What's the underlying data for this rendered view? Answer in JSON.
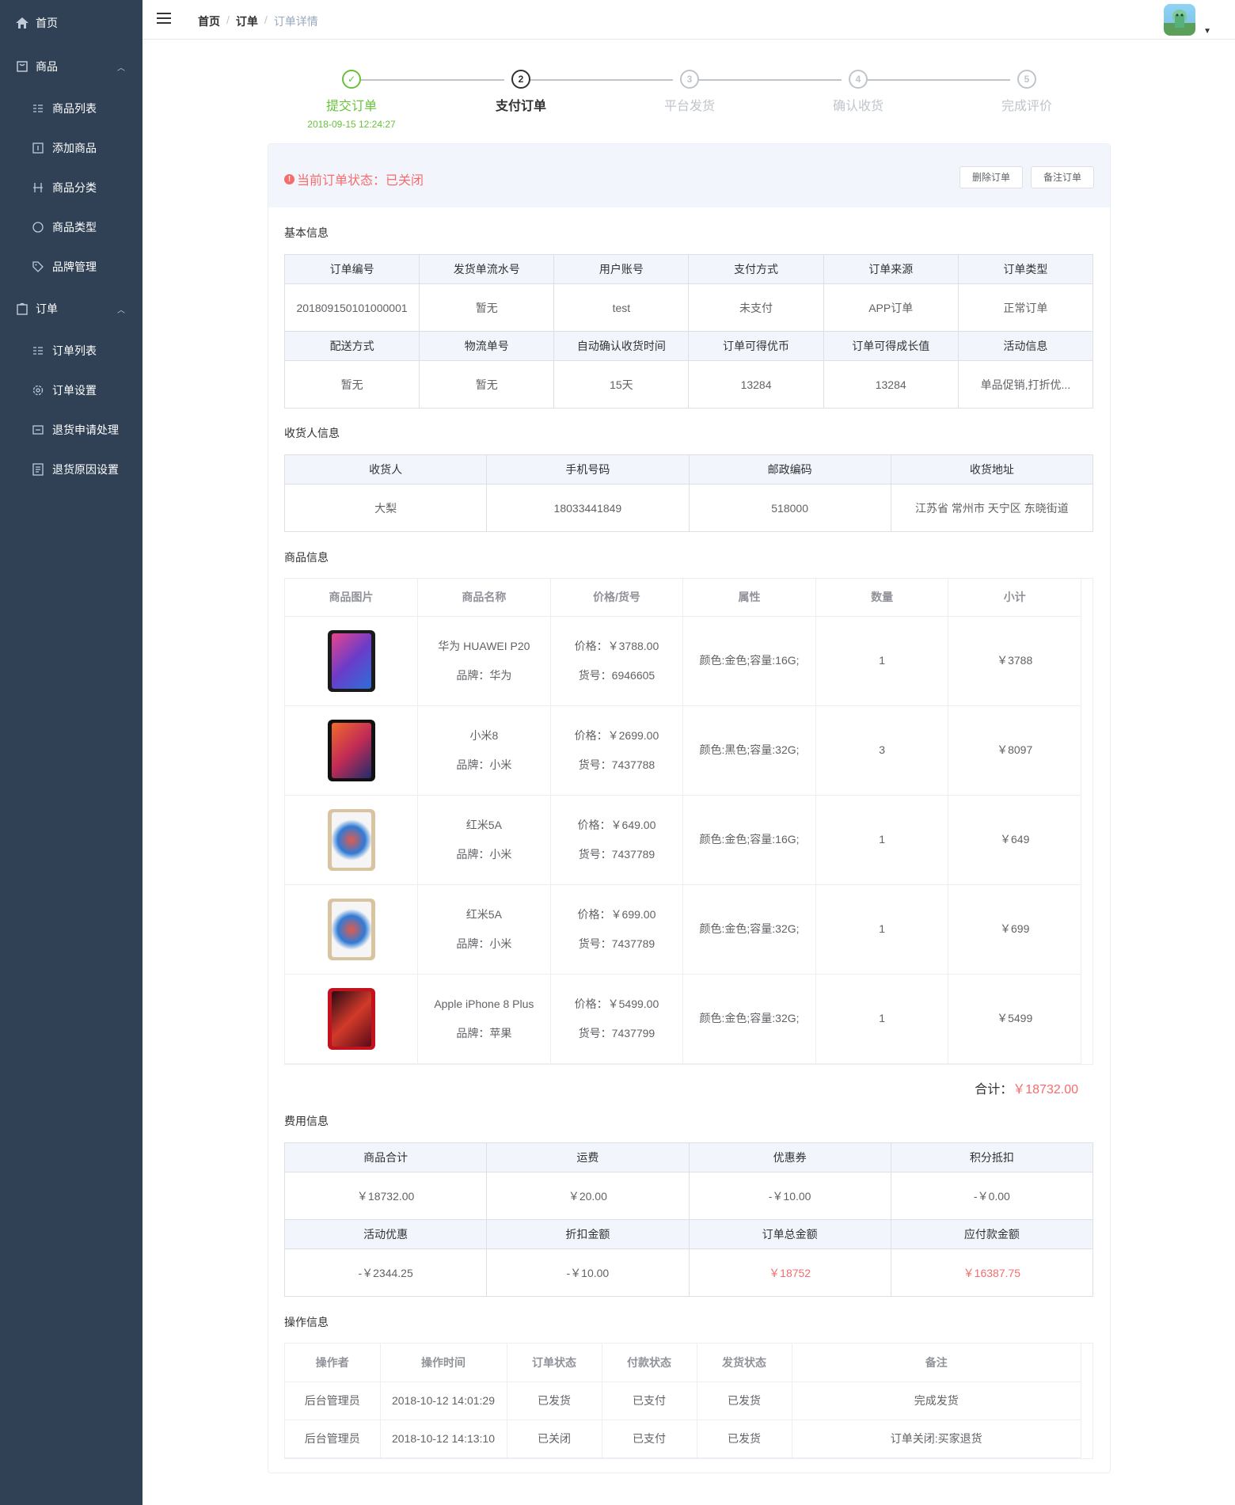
{
  "sidebar": {
    "items": [
      {
        "label": "首页",
        "icon": "home-icon"
      },
      {
        "label": "商品",
        "icon": "product-icon"
      },
      {
        "label": "商品列表",
        "icon": "list-icon"
      },
      {
        "label": "添加商品",
        "icon": "add-icon"
      },
      {
        "label": "商品分类",
        "icon": "category-icon"
      },
      {
        "label": "商品类型",
        "icon": "type-icon"
      },
      {
        "label": "品牌管理",
        "icon": "tag-icon"
      },
      {
        "label": "订单",
        "icon": "order-icon"
      },
      {
        "label": "订单列表",
        "icon": "list-icon"
      },
      {
        "label": "订单设置",
        "icon": "gear-icon"
      },
      {
        "label": "退货申请处理",
        "icon": "return-icon"
      },
      {
        "label": "退货原因设置",
        "icon": "document-icon"
      }
    ]
  },
  "breadcrumb": {
    "home": "首页",
    "sep": "/",
    "section": "订单",
    "current": "订单详情"
  },
  "steps": [
    {
      "title": "提交订单",
      "desc": "2018-09-15 12:24:27",
      "num": "✓"
    },
    {
      "title": "支付订单",
      "desc": "",
      "num": "2"
    },
    {
      "title": "平台发货",
      "desc": "",
      "num": "3"
    },
    {
      "title": "确认收货",
      "desc": "",
      "num": "4"
    },
    {
      "title": "完成评价",
      "desc": "",
      "num": "5"
    }
  ],
  "status": {
    "text": "当前订单状态：已关闭",
    "delete_btn": "删除订单",
    "note_btn": "备注订单"
  },
  "basic": {
    "title": "基本信息",
    "headers1": [
      "订单编号",
      "发货单流水号",
      "用户账号",
      "支付方式",
      "订单来源",
      "订单类型"
    ],
    "values1": [
      "201809150101000001",
      "暂无",
      "test",
      "未支付",
      "APP订单",
      "正常订单"
    ],
    "headers2": [
      "配送方式",
      "物流单号",
      "自动确认收货时间",
      "订单可得优币",
      "订单可得成长值",
      "活动信息"
    ],
    "values2": [
      "暂无",
      "暂无",
      "15天",
      "13284",
      "13284",
      "单品促销,打折优..."
    ]
  },
  "receiver": {
    "title": "收货人信息",
    "headers": [
      "收货人",
      "手机号码",
      "邮政编码",
      "收货地址"
    ],
    "values": [
      "大梨",
      "18033441849",
      "518000",
      "江苏省 常州市 天宁区 东晓街道"
    ]
  },
  "goods": {
    "title": "商品信息",
    "headers": [
      "商品图片",
      "商品名称",
      "价格/货号",
      "属性",
      "数量",
      "小计"
    ],
    "rows": [
      {
        "name": "华为 HUAWEI P20",
        "brand": "品牌：华为",
        "price": "价格：￥3788.00",
        "sn": "货号：6946605",
        "attr": "颜色:金色;容量:16G;",
        "qty": "1",
        "subtotal": "￥3788"
      },
      {
        "name": "小米8",
        "brand": "品牌：小米",
        "price": "价格：￥2699.00",
        "sn": "货号：7437788",
        "attr": "颜色:黑色;容量:32G;",
        "qty": "3",
        "subtotal": "￥8097"
      },
      {
        "name": "红米5A",
        "brand": "品牌：小米",
        "price": "价格：￥649.00",
        "sn": "货号：7437789",
        "attr": "颜色:金色;容量:16G;",
        "qty": "1",
        "subtotal": "￥649"
      },
      {
        "name": "红米5A",
        "brand": "品牌：小米",
        "price": "价格：￥699.00",
        "sn": "货号：7437789",
        "attr": "颜色:金色;容量:32G;",
        "qty": "1",
        "subtotal": "￥699"
      },
      {
        "name": "Apple iPhone 8 Plus",
        "brand": "品牌：苹果",
        "price": "价格：￥5499.00",
        "sn": "货号：7437799",
        "attr": "颜色:金色;容量:32G;",
        "qty": "1",
        "subtotal": "￥5499"
      }
    ],
    "total_label": "合计：",
    "total_value": "￥18732.00"
  },
  "fees": {
    "title": "费用信息",
    "headers1": [
      "商品合计",
      "运费",
      "优惠券",
      "积分抵扣"
    ],
    "values1": [
      "￥18732.00",
      "￥20.00",
      "-￥10.00",
      "-￥0.00"
    ],
    "headers2": [
      "活动优惠",
      "折扣金额",
      "订单总金额",
      "应付款金额"
    ],
    "values2": [
      "-￥2344.25",
      "-￥10.00",
      "￥18752",
      "￥16387.75"
    ]
  },
  "operations": {
    "title": "操作信息",
    "headers": [
      "操作者",
      "操作时间",
      "订单状态",
      "付款状态",
      "发货状态",
      "备注"
    ],
    "rows": [
      [
        "后台管理员",
        "2018-10-12 14:01:29",
        "已发货",
        "已支付",
        "已发货",
        "完成发货"
      ],
      [
        "后台管理员",
        "2018-10-12 14:13:10",
        "已关闭",
        "已支付",
        "已发货",
        "订单关闭:买家退货"
      ]
    ]
  },
  "colors": {
    "sidebar": "#304156",
    "success": "#67c23a",
    "danger": "#f56c6c",
    "header_bg": "#f2f6fc"
  }
}
